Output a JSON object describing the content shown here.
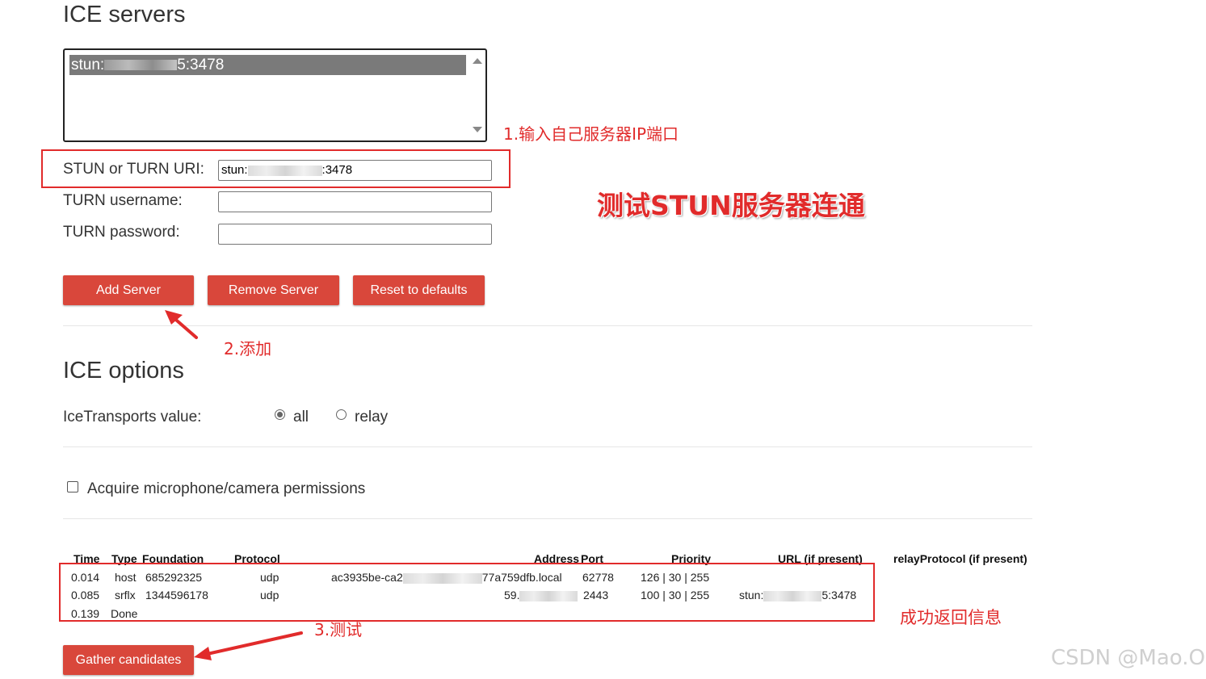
{
  "ice_servers": {
    "heading": "ICE servers",
    "list_item_prefix": "stun:",
    "list_item_suffix": "5:3478",
    "uri_label": "STUN or TURN URI:",
    "uri_prefix": "stun:",
    "uri_suffix": ":3478",
    "username_label": "TURN username:",
    "username_value": "",
    "password_label": "TURN password:",
    "password_value": ""
  },
  "buttons": {
    "add": "Add Server",
    "remove": "Remove Server",
    "reset": "Reset to defaults",
    "gather": "Gather candidates"
  },
  "ice_options": {
    "heading": "ICE options",
    "transports_label": "IceTransports value:",
    "transports_options": [
      "all",
      "relay"
    ],
    "transports_selected": "all",
    "acquire_label": "Acquire microphone/camera permissions",
    "acquire_checked": false
  },
  "candidates_table": {
    "headers": [
      "Time",
      "Type",
      "Foundation",
      "Protocol",
      "Address",
      "Port",
      "Priority",
      "URL (if present)",
      "relayProtocol (if present)"
    ],
    "rows": [
      {
        "time": "0.014",
        "type": "host",
        "foundation": "685292325",
        "protocol": "udp",
        "address_prefix": "ac3935be-ca2",
        "address_suffix": "77a759dfb.local",
        "port": "62778",
        "priority": "126 | 30 | 255",
        "url": ""
      },
      {
        "time": "0.085",
        "type": "srflx",
        "foundation": "1344596178",
        "protocol": "udp",
        "address_prefix": "59.",
        "address_suffix": "",
        "port": "2443",
        "priority": "100 | 30 | 255",
        "url_prefix": "stun:",
        "url_suffix": "5:3478"
      },
      {
        "time": "0.139",
        "status": "Done"
      }
    ]
  },
  "annotations": {
    "step1": "1.输入自己服务器IP端口",
    "title": "测试STUN服务器连通",
    "step2": "2.添加",
    "step3": "3.测试",
    "result": "成功返回信息"
  },
  "watermark": "CSDN @Mao.O",
  "colors": {
    "button": "#d9473b",
    "annotation": "#e12b2b"
  }
}
